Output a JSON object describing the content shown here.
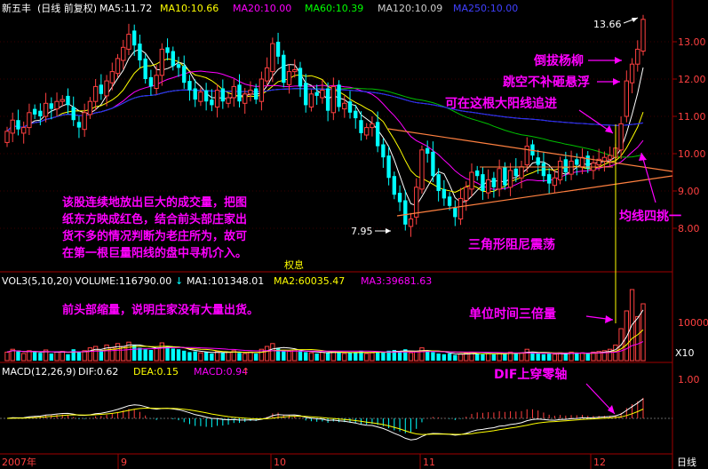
{
  "header": {
    "stock_name": "新五丰",
    "period": "(日线 前复权)",
    "ma_items": [
      {
        "label": "MA5:11.72",
        "color": "#ffffff"
      },
      {
        "label": "MA10:10.66",
        "color": "#ffff00"
      },
      {
        "label": "MA20:10.00",
        "color": "#ff00ff"
      },
      {
        "label": "MA60:10.39",
        "color": "#00ff00"
      },
      {
        "label": "MA120:10.09",
        "color": "#cccccc"
      },
      {
        "label": "MA250:10.00",
        "color": "#0000ff"
      }
    ]
  },
  "volume_header": {
    "title": "VOL3(5,10,20)",
    "volume": "VOLUME:116790.00",
    "ma1": "MA1:101348.01",
    "ma2": "MA2:60035.47",
    "ma3": "MA3:39681.63",
    "quanxi": "权息"
  },
  "macd_header": {
    "title": "MACD(12,26,9)",
    "dif": "DIF:0.62",
    "dea": "DEA:0.15",
    "macd": "MACD:0.94"
  },
  "annotations": {
    "a1": "倒拔杨柳",
    "a2": "跳空不补砸悬浮",
    "a3": "可在这根大阳线追进",
    "a4": "该股连续地放出巨大的成交量，把图",
    "a5": "纸东方映成红色，结合前头部庄家出",
    "a6": "货不多的情况判断为老庄所为，故可",
    "a7": "在第一根巨量阳线的盘中寻机介入。",
    "a8": "三角形阻尼震荡",
    "a9": "均线四挑一",
    "a10": "前头部缩量，说明庄家没有大量出货。",
    "a11": "单位时间三倍量",
    "a12": "DIF上穿零轴",
    "high_label": "13.66",
    "low_label": "7.95"
  },
  "axes": {
    "price_ticks": [
      "13.00",
      "12.00",
      "11.00",
      "10.00",
      "9.00",
      "8.00"
    ],
    "vol_tick": "10000",
    "vol_unit": "X10",
    "macd_tick": "1.00",
    "period_label": "日线",
    "x_labels": [
      "2007年",
      "9",
      "10",
      "11",
      "12"
    ]
  },
  "chart_data": {
    "type": "candlestick",
    "period": "daily",
    "price_range": [
      7.6,
      13.9
    ],
    "price_high": 13.66,
    "price_low": 7.95,
    "volume_unit": "X10",
    "macd_axis": [
      -1.4,
      1.4
    ],
    "months": [
      "2007-08",
      "2007-09",
      "2007-10",
      "2007-11",
      "2007-12"
    ],
    "last_values": {
      "MA5": 11.72,
      "MA10": 10.66,
      "MA20": 10.0,
      "MA60": 10.39,
      "MA120": 10.09,
      "MA250": 10.0,
      "VOLUME": 116790.0,
      "VOL_MA1": 101348.01,
      "VOL_MA2": 60035.47,
      "VOL_MA3": 39681.63,
      "DIF": 0.62,
      "DEA": 0.15,
      "MACD": 0.94
    },
    "closes": [
      10.6,
      10.9,
      10.65,
      10.7,
      11.1,
      11.05,
      11.0,
      11.35,
      11.2,
      11.4,
      11.45,
      11.3,
      10.9,
      10.7,
      11.1,
      11.4,
      11.8,
      11.6,
      11.95,
      12.2,
      12.55,
      12.85,
      13.2,
      12.9,
      12.5,
      12.0,
      11.8,
      12.1,
      12.8,
      12.7,
      12.35,
      12.3,
      11.9,
      11.7,
      11.45,
      11.65,
      11.4,
      11.3,
      11.7,
      11.4,
      11.5,
      11.8,
      11.4,
      11.6,
      11.7,
      11.45,
      12.0,
      12.3,
      12.95,
      12.6,
      11.9,
      12.2,
      12.25,
      11.8,
      11.3,
      11.6,
      11.55,
      11.7,
      11.15,
      11.8,
      11.25,
      11.35,
      11.1,
      10.95,
      10.55,
      10.7,
      10.8,
      10.2,
      9.9,
      9.35,
      8.9,
      8.7,
      8.1,
      8.25,
      9.1,
      10.1,
      10.0,
      9.4,
      9.0,
      8.8,
      8.6,
      8.3,
      8.8,
      9.1,
      9.5,
      9.4,
      9.0,
      9.3,
      9.1,
      9.6,
      9.15,
      9.55,
      9.4,
      9.65,
      10.2,
      9.95,
      9.7,
      9.4,
      9.2,
      9.35,
      9.8,
      9.5,
      9.8,
      9.7,
      9.9,
      9.6,
      9.75,
      9.85,
      9.9,
      9.95,
      10.15,
      10.8,
      11.95,
      12.4,
      12.8,
      13.6
    ],
    "opens": [
      10.3,
      10.55,
      10.9,
      10.55,
      10.7,
      11.2,
      11.15,
      11.0,
      11.35,
      11.2,
      11.4,
      11.55,
      11.25,
      10.85,
      10.65,
      11.05,
      11.4,
      11.85,
      11.55,
      11.9,
      12.15,
      12.5,
      12.8,
      13.3,
      12.95,
      12.55,
      12.05,
      11.75,
      12.1,
      12.85,
      12.75,
      12.4,
      12.35,
      11.95,
      11.75,
      11.4,
      11.7,
      11.45,
      11.25,
      11.75,
      11.35,
      11.5,
      11.85,
      11.35,
      11.6,
      11.75,
      11.4,
      11.95,
      12.2,
      13.0,
      12.65,
      11.85,
      12.2,
      12.3,
      11.9,
      11.25,
      11.65,
      11.5,
      11.75,
      11.1,
      11.85,
      11.2,
      11.4,
      11.15,
      10.9,
      10.5,
      10.7,
      10.85,
      10.25,
      9.95,
      9.4,
      8.95,
      8.75,
      8.05,
      8.3,
      9.05,
      10.15,
      10.05,
      9.45,
      9.05,
      8.85,
      8.55,
      8.25,
      8.75,
      9.05,
      9.55,
      9.45,
      8.95,
      9.35,
      9.05,
      9.65,
      9.1,
      9.6,
      9.35,
      9.7,
      10.25,
      9.9,
      9.75,
      9.45,
      9.15,
      9.3,
      9.85,
      9.45,
      9.85,
      9.65,
      9.95,
      9.55,
      9.7,
      9.8,
      9.85,
      9.9,
      10.1,
      11.0,
      11.9,
      12.4,
      12.75
    ],
    "volume_ratio": [
      0.12,
      0.16,
      0.13,
      0.1,
      0.14,
      0.12,
      0.11,
      0.15,
      0.1,
      0.12,
      0.13,
      0.09,
      0.16,
      0.12,
      0.14,
      0.18,
      0.2,
      0.15,
      0.22,
      0.18,
      0.24,
      0.2,
      0.26,
      0.22,
      0.18,
      0.16,
      0.15,
      0.17,
      0.25,
      0.2,
      0.17,
      0.16,
      0.14,
      0.12,
      0.13,
      0.11,
      0.12,
      0.1,
      0.13,
      0.11,
      0.12,
      0.14,
      0.11,
      0.1,
      0.12,
      0.1,
      0.16,
      0.2,
      0.24,
      0.18,
      0.14,
      0.13,
      0.15,
      0.13,
      0.12,
      0.11,
      0.1,
      0.12,
      0.11,
      0.13,
      0.12,
      0.1,
      0.11,
      0.12,
      0.14,
      0.1,
      0.11,
      0.13,
      0.12,
      0.14,
      0.15,
      0.12,
      0.16,
      0.11,
      0.13,
      0.18,
      0.14,
      0.12,
      0.1,
      0.09,
      0.1,
      0.08,
      0.09,
      0.1,
      0.12,
      0.1,
      0.09,
      0.1,
      0.09,
      0.11,
      0.1,
      0.12,
      0.1,
      0.11,
      0.16,
      0.12,
      0.1,
      0.09,
      0.1,
      0.09,
      0.11,
      0.1,
      0.12,
      0.1,
      0.11,
      0.1,
      0.12,
      0.13,
      0.14,
      0.16,
      0.22,
      0.45,
      0.7,
      1.0,
      0.62,
      0.8
    ]
  }
}
